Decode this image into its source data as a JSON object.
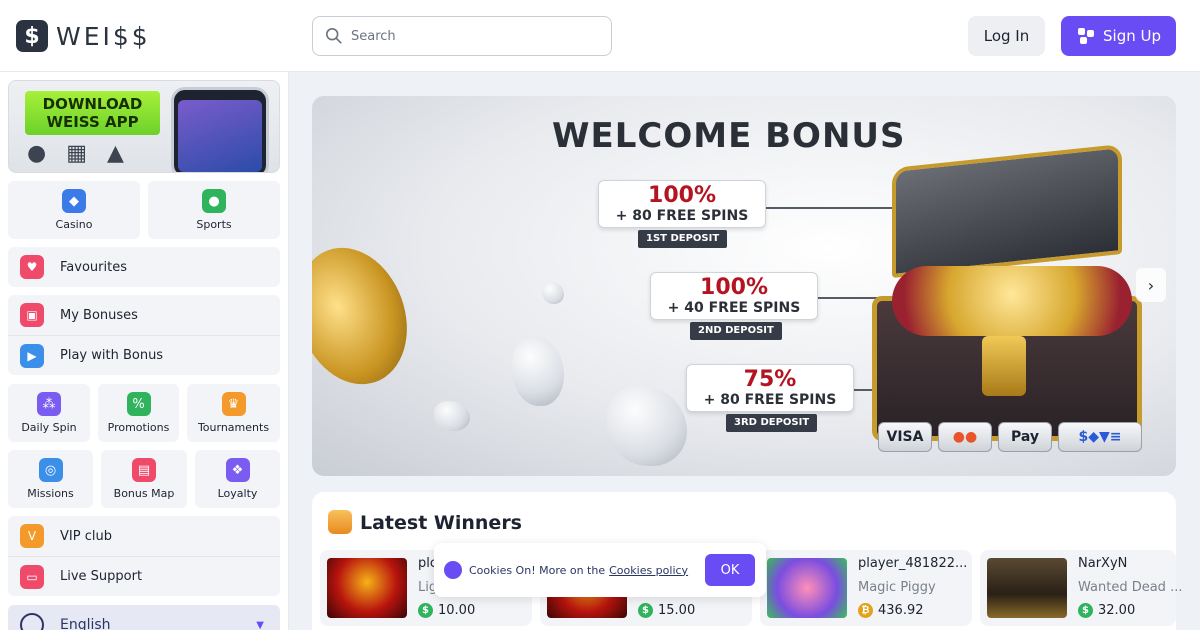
{
  "header": {
    "logo_text": "WEI$$",
    "logo_mark": "$",
    "search_placeholder": "Search",
    "login_label": "Log In",
    "signup_label": "Sign Up"
  },
  "sidebar": {
    "app_banner": {
      "line1": "DOWNLOAD",
      "line2": "WEISS APP"
    },
    "top_tiles": [
      {
        "label": "Casino",
        "icon": "casino-icon",
        "color": "#3b7be8"
      },
      {
        "label": "Sports",
        "icon": "sports-icon",
        "color": "#2fb35d"
      }
    ],
    "favourites": {
      "label": "Favourites",
      "icon": "heart-icon",
      "color": "#ef4a6a"
    },
    "bonus_group": [
      {
        "label": "My Bonuses",
        "icon": "gift-icon",
        "color": "#ef4a6a"
      },
      {
        "label": "Play with Bonus",
        "icon": "bonus-play-icon",
        "color": "#3b8fe8"
      }
    ],
    "mid_tiles": [
      {
        "label": "Daily Spin",
        "icon": "daily-spin-icon",
        "color": "#7b5cf0"
      },
      {
        "label": "Promotions",
        "icon": "promotions-icon",
        "color": "#2fb35d"
      },
      {
        "label": "Tournaments",
        "icon": "trophy-icon",
        "color": "#f39a2b"
      }
    ],
    "low_tiles": [
      {
        "label": "Missions",
        "icon": "target-icon",
        "color": "#3b8fe8"
      },
      {
        "label": "Bonus Map",
        "icon": "map-icon",
        "color": "#ef4a6a"
      },
      {
        "label": "Loyalty",
        "icon": "loyalty-icon",
        "color": "#7b5cf0"
      }
    ],
    "support_group": [
      {
        "label": "VIP club",
        "icon": "vip-icon",
        "color": "#f39a2b"
      },
      {
        "label": "Live Support",
        "icon": "chat-icon",
        "color": "#ef4a6a"
      }
    ],
    "language": {
      "label": "English"
    }
  },
  "hero": {
    "title": "WELCOME BONUS",
    "offers": [
      {
        "percent": "100%",
        "spins": "+ 80 FREE SPINS",
        "tag": "1ST DEPOSIT"
      },
      {
        "percent": "100%",
        "spins": "+ 40 FREE SPINS",
        "tag": "2ND DEPOSIT"
      },
      {
        "percent": "75%",
        "spins": "+ 80 FREE SPINS",
        "tag": "3RD DEPOSIT"
      }
    ],
    "payments": [
      "VISA",
      "●●",
      " Pay",
      "$◆▼≡"
    ]
  },
  "winners": {
    "title": "Latest Winners",
    "items": [
      {
        "player": "plc",
        "game": "Lig",
        "amount": "10.00",
        "coin_color": "#2fb35d",
        "coin": "$"
      },
      {
        "player": "",
        "game": "",
        "amount": "15.00",
        "coin_color": "#2fb35d",
        "coin": "$"
      },
      {
        "player": "player_481822...",
        "game": "Magic Piggy",
        "amount": "436.92",
        "coin_color": "#e3a21a",
        "coin": "₿"
      },
      {
        "player": "NarXyN",
        "game": "Wanted Dead ...",
        "amount": "32.00",
        "coin_color": "#2fb35d",
        "coin": "$"
      }
    ]
  },
  "cookie": {
    "text": "Cookies On! More on the",
    "link": "Cookies policy",
    "ok": "OK"
  }
}
